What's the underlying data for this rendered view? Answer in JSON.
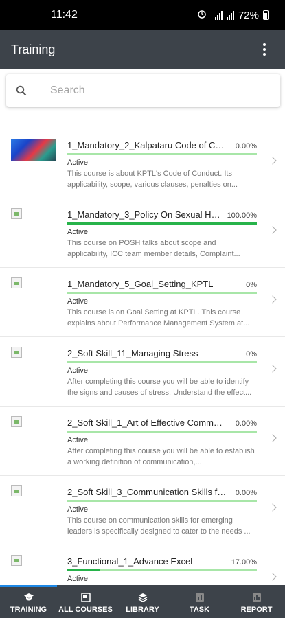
{
  "status_bar": {
    "time": "11:42",
    "battery": "72%"
  },
  "app_bar": {
    "title": "Training"
  },
  "search": {
    "placeholder": "Search"
  },
  "courses": [
    {
      "title": "1_Mandatory_2_Kalpataru Code of Con...",
      "percent": "0.00%",
      "progress": 0.0,
      "status": "Active",
      "description": "This course is about KPTL's Code of Conduct. Its applicability, scope, various clauses, penalties on...",
      "thumbnail": "image"
    },
    {
      "title": "1_Mandatory_3_Policy On Sexual Har...",
      "percent": "100.00%",
      "progress": 1.0,
      "status": "Active",
      "description": "This course on POSH talks about scope and applicability, ICC team member details, Complaint...",
      "thumbnail": "broken"
    },
    {
      "title": "1_Mandatory_5_Goal_Setting_KPTL",
      "percent": "0%",
      "progress": 0.0,
      "status": "Active",
      "description": "This course is on Goal Setting at KPTL. This course explains about Performance Management System at...",
      "thumbnail": "broken"
    },
    {
      "title": "2_Soft Skill_11_Managing Stress",
      "percent": "0%",
      "progress": 0.0,
      "status": "Active",
      "description": "After completing this course you will be able to identify the signs and causes of stress. Understand the effect...",
      "thumbnail": "broken"
    },
    {
      "title": "2_Soft Skill_1_Art of Effective Communi...",
      "percent": "0.00%",
      "progress": 0.0,
      "status": "Active",
      "description": "After completing this course you will be able to establish a working definition of communication,...",
      "thumbnail": "broken"
    },
    {
      "title": "2_Soft Skill_3_Communication Skills for...",
      "percent": "0.00%",
      "progress": 0.0,
      "status": "Active",
      "description": "This course on communication skills for emerging leaders is specifically designed to cater to the needs ...",
      "thumbnail": "broken"
    },
    {
      "title": "3_Functional_1_Advance Excel",
      "percent": "17.00%",
      "progress": 0.17,
      "status": "Active",
      "description": "",
      "thumbnail": "broken"
    }
  ],
  "bottom_nav": [
    {
      "label": "TRAINING",
      "icon": "graduation-cap-icon",
      "active": true
    },
    {
      "label": "ALL COURSES",
      "icon": "courses-icon",
      "active": false
    },
    {
      "label": "LIBRARY",
      "icon": "library-icon",
      "active": false
    },
    {
      "label": "TASK",
      "icon": "task-icon",
      "active": false
    },
    {
      "label": "REPORT",
      "icon": "report-icon",
      "active": false
    }
  ],
  "colors": {
    "app_bar": "#3d434a",
    "progress_fill": "#27b34a",
    "progress_track": "#a8e6a8",
    "nav_indicator": "#1e88e5"
  }
}
